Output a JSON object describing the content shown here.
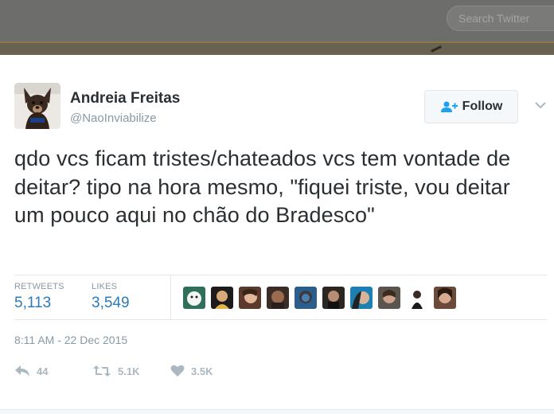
{
  "header": {
    "search": {
      "placeholder": "Search Twitter",
      "icon": "search-box"
    }
  },
  "tweet": {
    "author": {
      "name": "Andreia Freitas",
      "handle": "@NaoInviabilize"
    },
    "follow_label": "Follow",
    "text": "qdo vcs ficam tristes/chateados vcs tem vontade de deitar? tipo na hora mesmo, \"fiquei triste, vou deitar um pouco aqui no chão do Bradesco\"",
    "stats": [
      {
        "label": "RETWEETS",
        "value": "5,113"
      },
      {
        "label": "LIKES",
        "value": "3,549"
      }
    ],
    "liker_avatar_count": 9,
    "timestamp": "8:11 AM - 22 Dec 2015",
    "actions": [
      {
        "icon": "reply-icon",
        "count": "44"
      },
      {
        "icon": "retweet-icon",
        "count": "5.1K"
      },
      {
        "icon": "like-icon",
        "count": "3.5K"
      }
    ]
  },
  "colors": {
    "text": "#292f33",
    "muted": "#8899a6",
    "link_blue": "#2b7bb9",
    "action_gray": "#aab8c2",
    "border": "#e1e8ed"
  }
}
